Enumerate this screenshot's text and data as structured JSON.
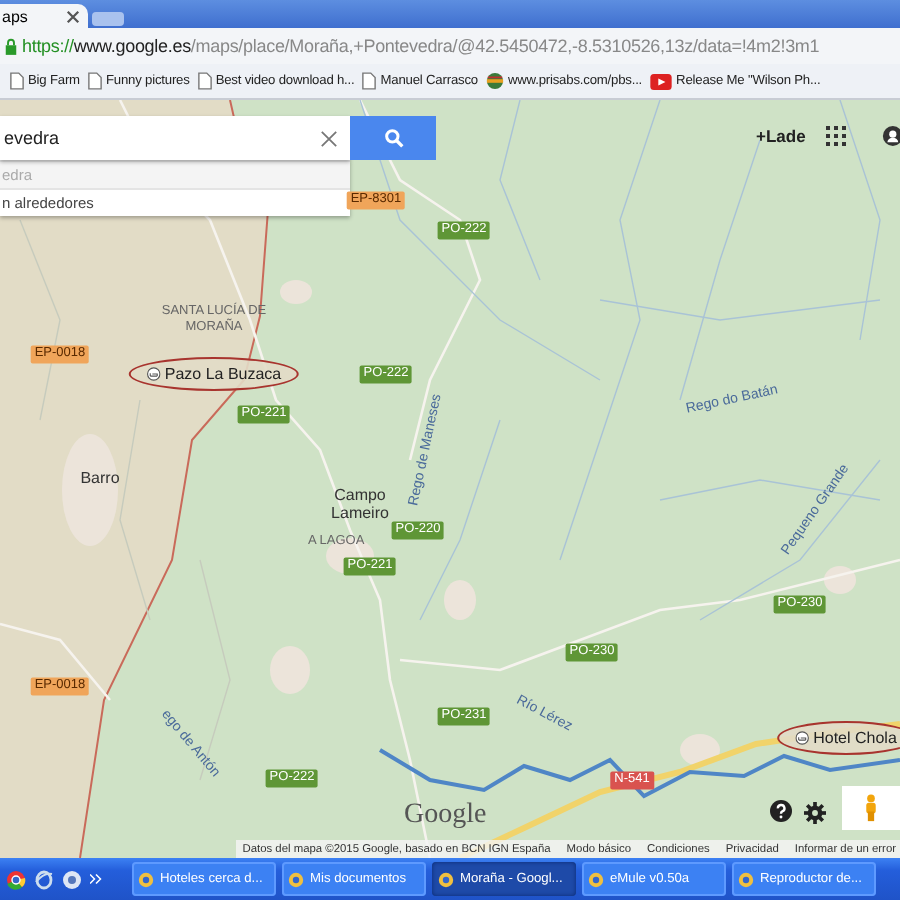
{
  "browser": {
    "tab": {
      "title": "aps"
    },
    "url": {
      "scheme": "https://",
      "host": "www.google.es",
      "path": "/maps/place/Moraña,+Pontevedra/@42.5450472,-8.5310526,13z/data=!4m2!3m1"
    },
    "bookmarks": [
      {
        "label": "Big Farm",
        "kind": "page"
      },
      {
        "label": "Funny pictures",
        "kind": "page"
      },
      {
        "label": "Best video download h...",
        "kind": "page"
      },
      {
        "label": "Manuel Carrasco",
        "kind": "page"
      },
      {
        "label": "www.prisabs.com/pbs...",
        "kind": "site"
      },
      {
        "label": "Release Me \"Wilson Ph...",
        "kind": "video"
      }
    ]
  },
  "search": {
    "value": "evedra",
    "suggestions": [
      "edra",
      "n alrededores"
    ]
  },
  "account": {
    "link": "+Lade"
  },
  "map": {
    "roads": [
      {
        "label": "EP-8301",
        "kind": "ep"
      },
      {
        "label": "PO-222",
        "kind": "po"
      },
      {
        "label": "EP-0018",
        "kind": "ep"
      },
      {
        "label": "PO-222",
        "kind": "po"
      },
      {
        "label": "PO-221",
        "kind": "po"
      },
      {
        "label": "PO-220",
        "kind": "po"
      },
      {
        "label": "PO-221",
        "kind": "po"
      },
      {
        "label": "EP-0018",
        "kind": "ep"
      },
      {
        "label": "PO-230",
        "kind": "po"
      },
      {
        "label": "PO-230",
        "kind": "po"
      },
      {
        "label": "PO-231",
        "kind": "po"
      },
      {
        "label": "PO-222",
        "kind": "po"
      },
      {
        "label": "N-541",
        "kind": "n"
      }
    ],
    "places": [
      {
        "label": "SANTA LUCÍA DE MORAÑA",
        "kind": "area"
      },
      {
        "label": "Pazo La Buzaca",
        "kind": "hotel"
      },
      {
        "label": "Barro",
        "kind": "town"
      },
      {
        "label": "Campo Lameiro",
        "kind": "town"
      },
      {
        "label": "A LAGOA",
        "kind": "area"
      },
      {
        "label": "Rego de Maneses",
        "kind": "water"
      },
      {
        "label": "Rego do Batán",
        "kind": "water"
      },
      {
        "label": "Pequeno Grande",
        "kind": "water"
      },
      {
        "label": "Río Lérez",
        "kind": "water"
      },
      {
        "label": "ego de Antón",
        "kind": "water"
      },
      {
        "label": "Hotel Chola",
        "kind": "hotel"
      }
    ]
  },
  "footer": {
    "logo": "Google",
    "attribution": "Datos del mapa ©2015 Google, basado en BCN IGN España",
    "links": [
      "Modo básico",
      "Condiciones",
      "Privacidad",
      "Informar de un error"
    ]
  },
  "taskbar": {
    "items": [
      {
        "label": "Hoteles cerca d...",
        "selected": false
      },
      {
        "label": "Mis documentos",
        "selected": false
      },
      {
        "label": "Moraña - Googl...",
        "selected": true
      },
      {
        "label": "eMule v0.50a",
        "selected": false
      },
      {
        "label": "Reproductor de...",
        "selected": false
      }
    ]
  }
}
